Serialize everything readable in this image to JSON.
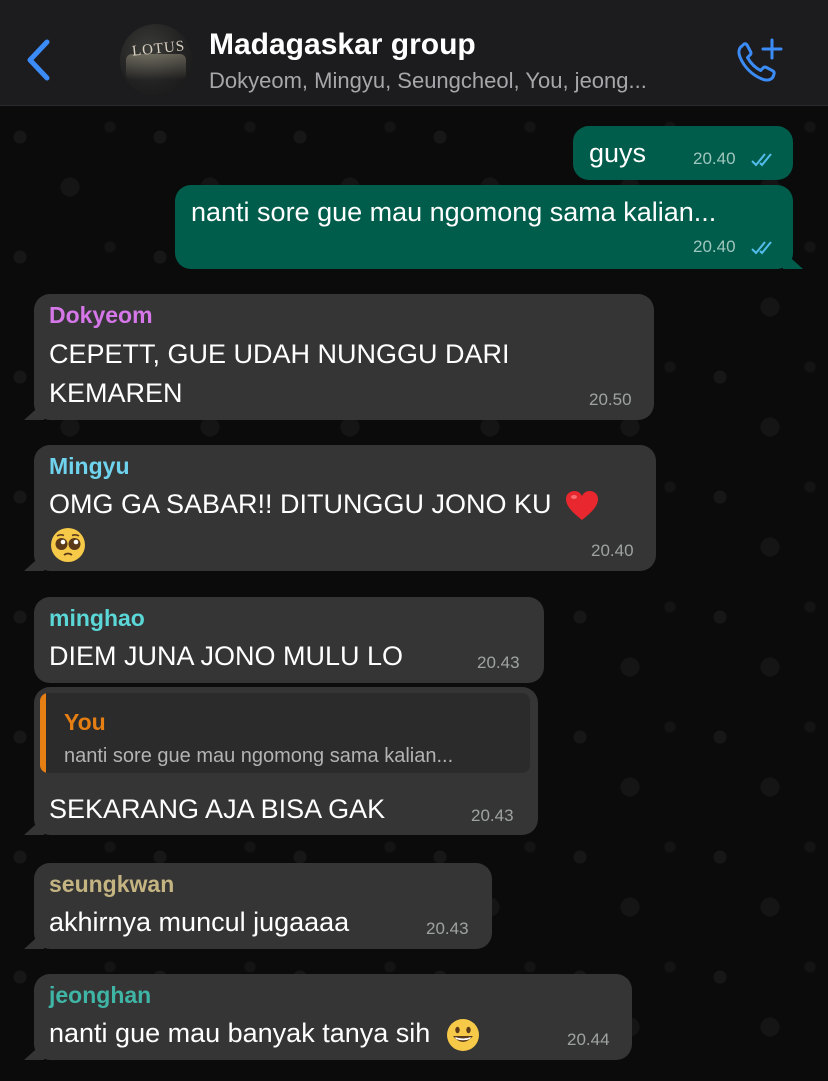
{
  "header": {
    "back_icon": "chevron-left-icon",
    "avatar_text": "LOTUS",
    "title": "Madagaskar group",
    "subtitle": "Dokyeom, Mingyu, Seungcheol, You, jeong...",
    "call_icon": "phone-add-icon"
  },
  "colors": {
    "accent": "#3c8cf7",
    "out_bubble": "#005c4b",
    "in_bubble": "#353535",
    "dokyeom": "#d577e8",
    "mingyu": "#6fd3ee",
    "minghao": "#5ad7d6",
    "you": "#e57e13",
    "seungkwan": "#c4b482",
    "jeonghan": "#3fb5a6"
  },
  "messages": [
    {
      "direction": "out",
      "text": "guys",
      "time": "20.40",
      "status": "read-double-check-icon"
    },
    {
      "direction": "out",
      "text": "nanti sore gue mau ngomong sama kalian...",
      "time": "20.40",
      "status": "read-double-check-icon"
    },
    {
      "direction": "in",
      "sender": "Dokyeom",
      "line1": "CEPETT, GUE UDAH NUNGGU DARI",
      "line2": "KEMAREN",
      "time": "20.50"
    },
    {
      "direction": "in",
      "sender": "Mingyu",
      "line1": "OMG GA SABAR!! DITUNGGU JONO KU",
      "time": "20.40",
      "emoji1": "red-heart-icon",
      "emoji2": "pleading-face-icon"
    },
    {
      "direction": "in",
      "sender": "minghao",
      "text": "DIEM JUNA JONO MULU LO",
      "time": "20.43"
    },
    {
      "direction": "in",
      "quote_sender": "You",
      "quote_text": "nanti sore gue mau ngomong sama kalian...",
      "text": "SEKARANG AJA BISA GAK",
      "time": "20.43"
    },
    {
      "direction": "in",
      "sender": "seungkwan",
      "text": "akhirnya muncul jugaaaa",
      "time": "20.43"
    },
    {
      "direction": "in",
      "sender": "jeonghan",
      "text": "nanti gue mau banyak tanya sih",
      "time": "20.44",
      "emoji1": "grinning-face-icon"
    }
  ]
}
